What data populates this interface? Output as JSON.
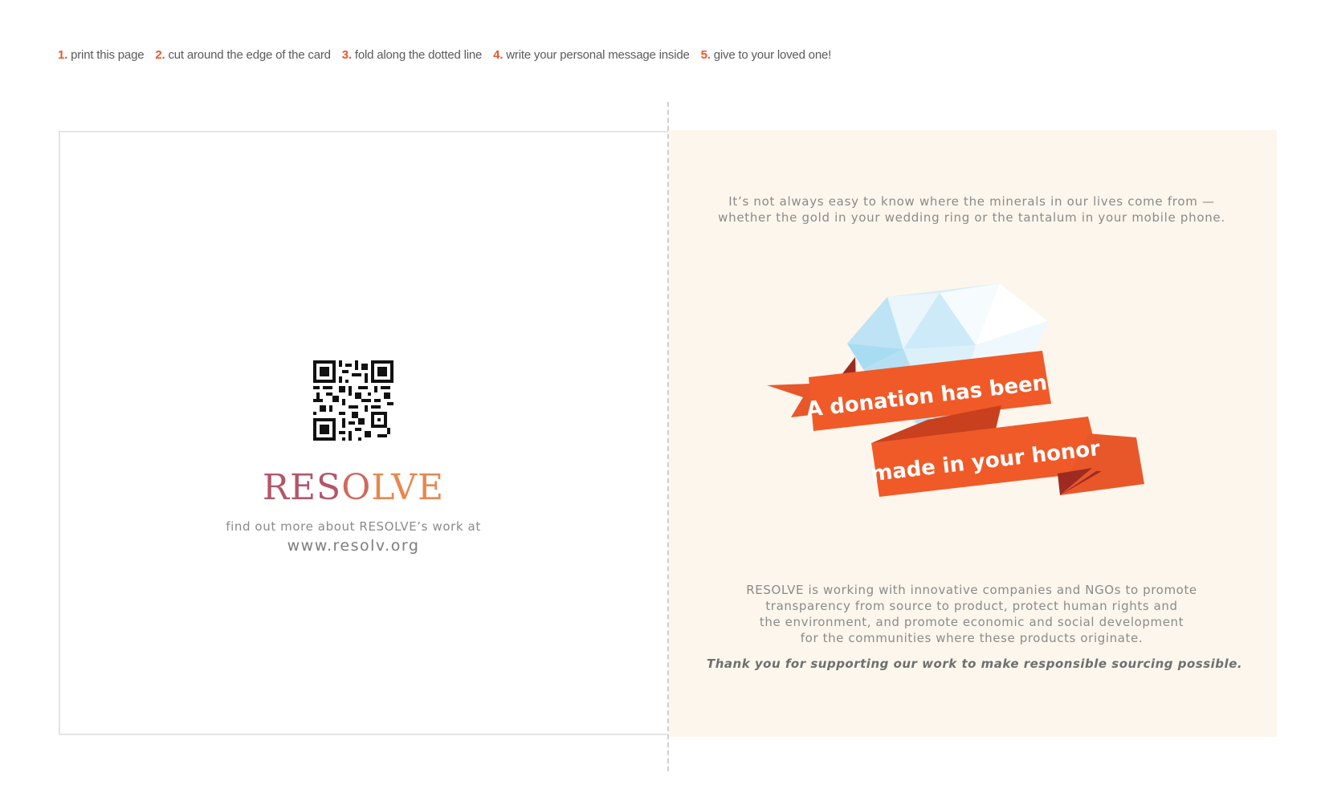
{
  "instructions": [
    {
      "num": "1.",
      "text": "print this page"
    },
    {
      "num": "2.",
      "text": "cut around the edge of the card"
    },
    {
      "num": "3.",
      "text": "fold along the dotted line"
    },
    {
      "num": "4.",
      "text": "write your personal message inside"
    },
    {
      "num": "5.",
      "text": "give to your loved one!"
    }
  ],
  "left": {
    "logo": {
      "part1": "RES",
      "part2": "O",
      "part3": "LVE"
    },
    "find_out": "find out more about RESOLVE’s work at",
    "url": "www.resolv.org"
  },
  "right": {
    "intro": [
      "It’s not always easy to know where the minerals in our lives come from —",
      "whether the gold in your wedding ring or the tantalum in your mobile phone."
    ],
    "ribbon_line1": "A donation has been",
    "ribbon_line2": "made in your honor",
    "mission": [
      "RESOLVE is working with innovative companies and NGOs to promote",
      "transparency from source to product, protect human rights and",
      "the environment, and promote economic and social development",
      "for the communities where these products originate."
    ],
    "thanks": "Thank you for supporting our work to make responsible sourcing possible."
  },
  "colors": {
    "accent": "#e8572a",
    "ribbon": "#f05a28",
    "ribbon_dark": "#c9401f",
    "card_bg": "#fcf6ec"
  }
}
